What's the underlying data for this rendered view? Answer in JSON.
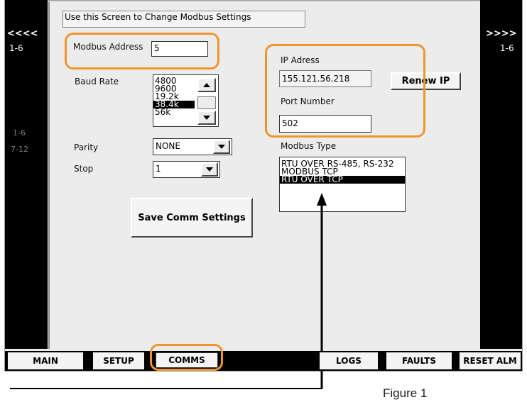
{
  "header": {
    "instruction": "Use this Screen to Change Modbus Settings"
  },
  "left_nav": {
    "arrow": "<<<<",
    "range": "1-6",
    "dim1": "1-6",
    "dim2": "7-12"
  },
  "right_nav": {
    "arrow": ">>>>",
    "range": "1-6"
  },
  "modbus": {
    "label": "Modbus Address",
    "value": "5"
  },
  "baud": {
    "label": "Baud Rate",
    "options": [
      "4800",
      "9600",
      "19.2k",
      "38.4k",
      "56k"
    ],
    "selected": "38.4k"
  },
  "parity": {
    "label": "Parity",
    "value": "NONE"
  },
  "stop": {
    "label": "Stop",
    "value": "1"
  },
  "save_button": "Save Comm Settings",
  "ip": {
    "label": "IP Adress",
    "value": "155.121.56.218",
    "renew_button": "Renew IP"
  },
  "port": {
    "label": "Port Number",
    "value": "502"
  },
  "modbus_type": {
    "label": "Modbus Type",
    "options": [
      "RTU OVER RS-485, RS-232",
      "MODBUS TCP",
      "RTU OVER TCP"
    ],
    "selected": "RTU OVER TCP"
  },
  "tabs": {
    "main": "MAIN",
    "setup": "SETUP",
    "comms": "COMMS",
    "logs": "LOGS",
    "faults": "FAULTS",
    "reset": "RESET ALM"
  },
  "caption": "Figure 1",
  "colors": {
    "highlight": "#f0952d",
    "panel": "#ececec",
    "selection": "#000000"
  }
}
